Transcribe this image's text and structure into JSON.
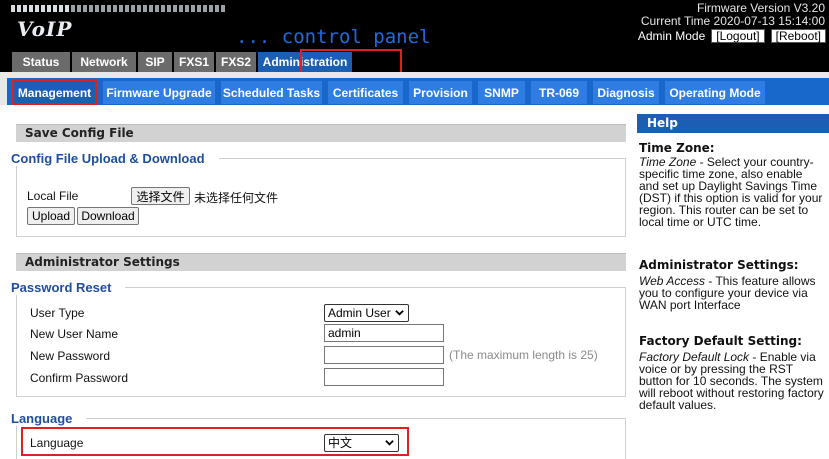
{
  "header": {
    "logo": "VoIP",
    "subtitle": "... control panel",
    "firmware": "Firmware Version V3.20",
    "current_time": "Current Time 2020-07-13 15:14:00",
    "admin_mode": "Admin Mode",
    "logout": "[Logout]",
    "reboot": "[Reboot]"
  },
  "top_tabs": [
    "Status",
    "Network",
    "SIP",
    "FXS1",
    "FXS2",
    "Administration"
  ],
  "sub_tabs": [
    "Management",
    "Firmware Upgrade",
    "Scheduled Tasks",
    "Certificates",
    "Provision",
    "SNMP",
    "TR-069",
    "Diagnosis",
    "Operating Mode"
  ],
  "save_config": {
    "title": "Save Config File",
    "fieldset": "Config File Upload & Download",
    "local_file_label": "Local File",
    "choose_file_button": "选择文件",
    "no_file_text": "未选择任何文件",
    "upload_button": "Upload",
    "download_button": "Download"
  },
  "admin_settings": {
    "title": "Administrator Settings",
    "password_reset": "Password Reset",
    "user_type_label": "User Type",
    "user_type_value": "Admin User",
    "new_user_name_label": "New User Name",
    "new_user_name_value": "admin",
    "new_password_label": "New Password",
    "confirm_password_label": "Confirm Password",
    "max_length_hint": "(The maximum length is 25)"
  },
  "language": {
    "fieldset": "Language",
    "label": "Language",
    "value": "中文"
  },
  "help": {
    "title": "Help",
    "time_zone_heading": "Time Zone:",
    "time_zone_term": "Time Zone",
    "time_zone_text": " - Select your country-specific time zone, also enable and set up Daylight Savings Time (DST) if this option is valid for your region. This router can be set to local time or UTC time.",
    "admin_heading": "Administrator Settings:",
    "admin_term": "Web Access",
    "admin_text": " - This feature allows you to configure your device via WAN port Interface",
    "factory_heading": "Factory Default Setting:",
    "factory_term": "Factory Default Lock",
    "factory_text": " - Enable via voice or by pressing the RST button for 10 seconds. The system will reboot without restoring factory default values."
  },
  "colors": {
    "header_bg": "#000000",
    "accent_blue": "#1a5fb4",
    "tab_blue": "#2f7de2",
    "tab_gray": "#6b6b6b",
    "highlight_red": "#e02020",
    "fieldset_title": "#1f4e9e"
  },
  "icons": {
    "select_chevron": "chevron-down-icon"
  }
}
